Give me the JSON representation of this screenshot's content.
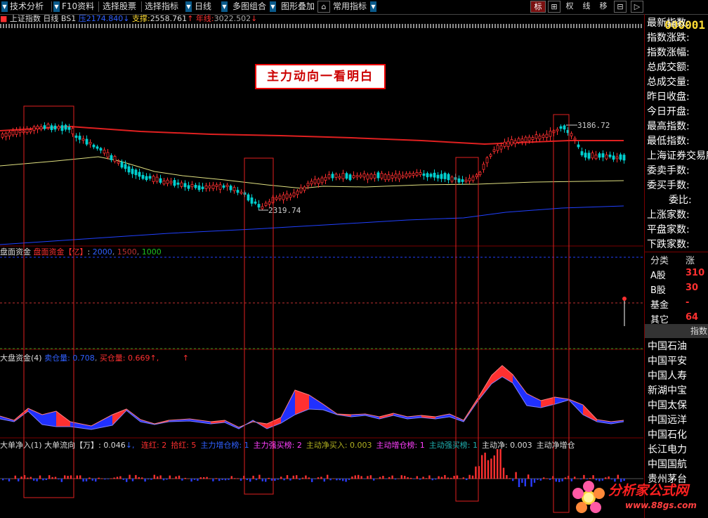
{
  "toolbar": {
    "items": [
      "技术分析",
      "F10资料",
      "选择股票",
      "选择指标",
      "日线",
      "多图组合",
      "图形叠加",
      "常用指标"
    ],
    "right_buttons": [
      "标",
      "⊞",
      "权",
      "线",
      "移",
      "⊟",
      "▷"
    ]
  },
  "stock_code": "000001",
  "info": {
    "name": "上证指数",
    "period": "日线",
    "bs": "BS1",
    "pressure_label": "压",
    "pressure": "2174.840",
    "support_label": "支撑:",
    "support": "2558.761",
    "line_label": "年线:",
    "line_value": "3022.502"
  },
  "chart_title": "主力动向一看明白",
  "annotations": {
    "high_label": "3186.72",
    "low_label": "2319.74"
  },
  "panel2": {
    "name": "盘面资金",
    "title": "盘面资金【亿】",
    "levels": [
      "2000",
      "1500",
      "1000"
    ]
  },
  "panel3": {
    "name": "大盘资金(4)",
    "sell_label": "卖仓量:",
    "sell_value": "0.708",
    "buy_label": "买仓量:",
    "buy_value": "0.669"
  },
  "panel4": {
    "name": "大单净入(1)",
    "flow_label": "大单流向【万】:",
    "flow_value": "0.046",
    "items": [
      {
        "text": "连红: 2",
        "color": "#ff3030"
      },
      {
        "text": "拾红: 5",
        "color": "#ff3030"
      },
      {
        "text": "主力增仓榜: 1",
        "color": "#3060ff"
      },
      {
        "text": "主力强买榜: 2",
        "color": "#ff40ff"
      },
      {
        "text": "主动净买入: 0.003",
        "color": "#b0b020"
      },
      {
        "text": "主动增仓榜: 1",
        "color": "#ff40ff"
      },
      {
        "text": "主动强买榜: 1",
        "color": "#20b0b0"
      },
      {
        "text": "主动净: 0.003",
        "color": "#dddddd"
      },
      {
        "text": "主动净增仓",
        "color": "#dddddd"
      }
    ]
  },
  "right_panel": {
    "labels": [
      "最新指数:",
      "指数涨跌:",
      "指数涨幅:",
      "总成交额:",
      "总成交量:",
      "昨日收盘:",
      "今日开盘:",
      "最高指数:",
      "最低指数:",
      "上海证券交易所",
      "委卖手数:",
      "委买手数:",
      "委比:",
      "上涨家数:",
      "平盘家数:",
      "下跌家数:"
    ],
    "category_header": [
      "分类",
      "涨"
    ],
    "categories": [
      {
        "name": "A股",
        "value": "310"
      },
      {
        "name": "B股",
        "value": "30"
      },
      {
        "name": "基金",
        "value": "-"
      },
      {
        "name": "其它",
        "value": "64"
      }
    ],
    "tab_label": "指数",
    "stocks": [
      "中国石油",
      "中国平安",
      "中国人寿",
      "新湖中宝",
      "中国太保",
      "中国远洋",
      "中国石化",
      "长江电力",
      "中国国航",
      "贵州茅台"
    ]
  },
  "watermark": {
    "text": "分析家公式网",
    "url": "www.88gs.com"
  },
  "colors": {
    "up": "#ff3030",
    "down": "#00d0d0",
    "ma_long": "#e02020",
    "ma_mid": "#e0e080",
    "ma_blue": "#2040ff",
    "highlight_box": "#e02020"
  }
}
